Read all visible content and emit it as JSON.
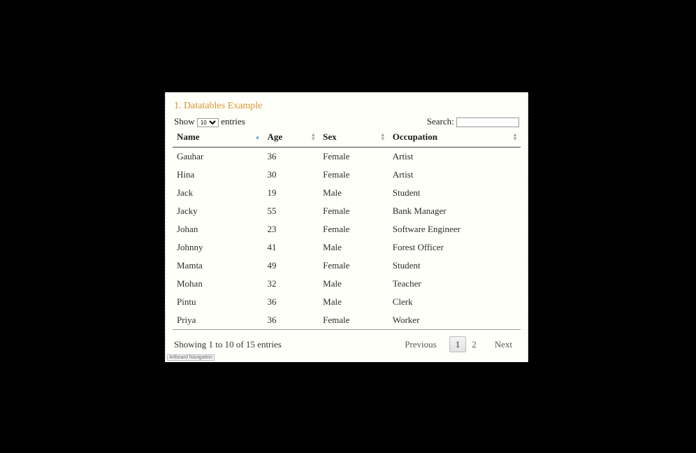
{
  "heading": "1. Datatables Example",
  "length": {
    "prefix": "Show",
    "suffix": "entries",
    "selected": "10"
  },
  "search": {
    "label": "Search:",
    "value": ""
  },
  "columns": {
    "name": "Name",
    "age": "Age",
    "sex": "Sex",
    "occupation": "Occupation"
  },
  "rows": [
    {
      "name": "Gauhar",
      "age": "36",
      "sex": "Female",
      "occupation": "Artist"
    },
    {
      "name": "Hina",
      "age": "30",
      "sex": "Female",
      "occupation": "Artist"
    },
    {
      "name": "Jack",
      "age": "19",
      "sex": "Male",
      "occupation": "Student"
    },
    {
      "name": "Jacky",
      "age": "55",
      "sex": "Female",
      "occupation": "Bank Manager"
    },
    {
      "name": "Johan",
      "age": "23",
      "sex": "Female",
      "occupation": "Software Engineer"
    },
    {
      "name": "Johnny",
      "age": "41",
      "sex": "Male",
      "occupation": "Forest Officer"
    },
    {
      "name": "Mamta",
      "age": "49",
      "sex": "Female",
      "occupation": "Student"
    },
    {
      "name": "Mohan",
      "age": "32",
      "sex": "Male",
      "occupation": "Teacher"
    },
    {
      "name": "Pintu",
      "age": "36",
      "sex": "Male",
      "occupation": "Clerk"
    },
    {
      "name": "Priya",
      "age": "36",
      "sex": "Female",
      "occupation": "Worker"
    }
  ],
  "info": "Showing 1 to 10 of 15 entries",
  "paginate": {
    "previous": "Previous",
    "next": "Next",
    "pages": [
      "1",
      "2"
    ],
    "current": "1"
  },
  "artboard_nav": "Artboard Navigation"
}
